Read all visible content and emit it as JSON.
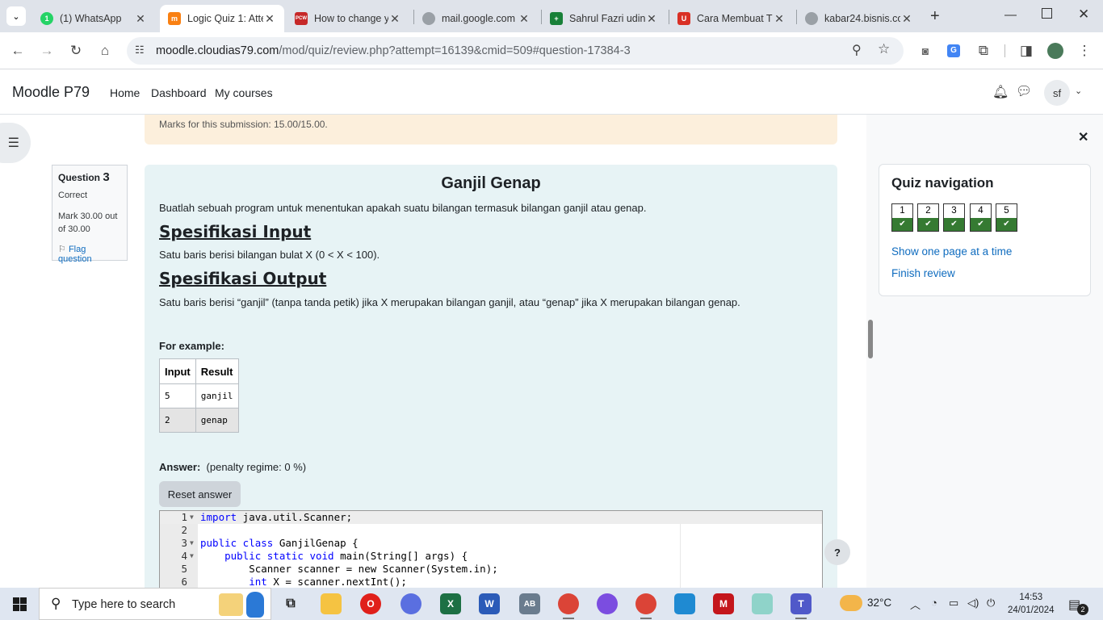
{
  "browser": {
    "tabs": [
      {
        "title": "(1) WhatsApp",
        "favicon": "whatsapp-icon",
        "color": "#25d366"
      },
      {
        "title": "Logic Quiz 1: Atte",
        "favicon": "moodle-icon",
        "color": "#f98012"
      },
      {
        "title": "How to change y",
        "favicon": "pcw-icon",
        "color": "#c62828"
      },
      {
        "title": "mail.google.com",
        "favicon": "globe-icon",
        "color": "#9aa0a6"
      },
      {
        "title": "Sahrul Fazri udin",
        "favicon": "sheets-icon",
        "color": "#188038"
      },
      {
        "title": "Cara Membuat T",
        "favicon": "magnet-icon",
        "color": "#d93025"
      },
      {
        "title": "kabar24.bisnis.co",
        "favicon": "globe-icon",
        "color": "#9aa0a6"
      }
    ],
    "url_host": "moodle.cloudias79.com",
    "url_path": "/mod/quiz/review.php?attempt=16139&cmid=509#question-17384-3"
  },
  "navbar": {
    "brand": "Moodle P79",
    "links": [
      "Home",
      "Dashboard",
      "My courses"
    ],
    "avatar": "sf"
  },
  "previous_feedback": {
    "marks_text": "Marks for this submission: 15.00/15.00."
  },
  "question_info": {
    "label": "Question",
    "number": "3",
    "state": "Correct",
    "mark_line1": "Mark 30.00 out",
    "mark_line2": "of 30.00",
    "flag": "Flag question"
  },
  "question": {
    "title": "Ganjil Genap",
    "intro": "Buatlah sebuah program untuk menentukan apakah suatu bilangan termasuk bilangan ganjil atau genap.",
    "input_heading": "Spesifikasi Input",
    "input_text": "Satu baris berisi bilangan bulat X (0 < X < 100).",
    "output_heading": "Spesifikasi Output",
    "output_text": "Satu baris berisi “ganjil” (tanpa tanda petik) jika X merupakan bilangan ganjil, atau “genap” jika X merupakan bilangan genap.",
    "example_label": "For example:",
    "example_headers": [
      "Input",
      "Result"
    ],
    "example_rows": [
      [
        "5",
        "ganjil"
      ],
      [
        "2",
        "genap"
      ]
    ],
    "answer_label": "Answer:",
    "penalty": "(penalty regime: 0 %)",
    "reset_button": "Reset answer"
  },
  "code_lines": [
    {
      "n": "1",
      "fold": true,
      "kw": "import",
      "rest": " java.util.Scanner;"
    },
    {
      "n": "2",
      "fold": false,
      "kw": "",
      "rest": ""
    },
    {
      "n": "3",
      "fold": true,
      "kw": "public class",
      "rest": " GanjilGenap {"
    },
    {
      "n": "4",
      "fold": true,
      "kw": "    public static void",
      "rest": " main(String[] args) {"
    },
    {
      "n": "5",
      "fold": false,
      "kw": "",
      "rest": "        Scanner scanner = new Scanner(System.in);"
    },
    {
      "n": "6",
      "fold": false,
      "kw": "        int",
      "rest": " X = scanner.nextInt();"
    }
  ],
  "quiz_navigation": {
    "title": "Quiz navigation",
    "buttons": [
      "1",
      "2",
      "3",
      "4",
      "5"
    ],
    "show_one_page": "Show one page at a time",
    "finish_review": "Finish review"
  },
  "help": "?",
  "taskbar": {
    "search_placeholder": "Type here to search",
    "weather": "32°C",
    "time": "14:53",
    "date": "24/01/2024",
    "notifications": "2"
  }
}
